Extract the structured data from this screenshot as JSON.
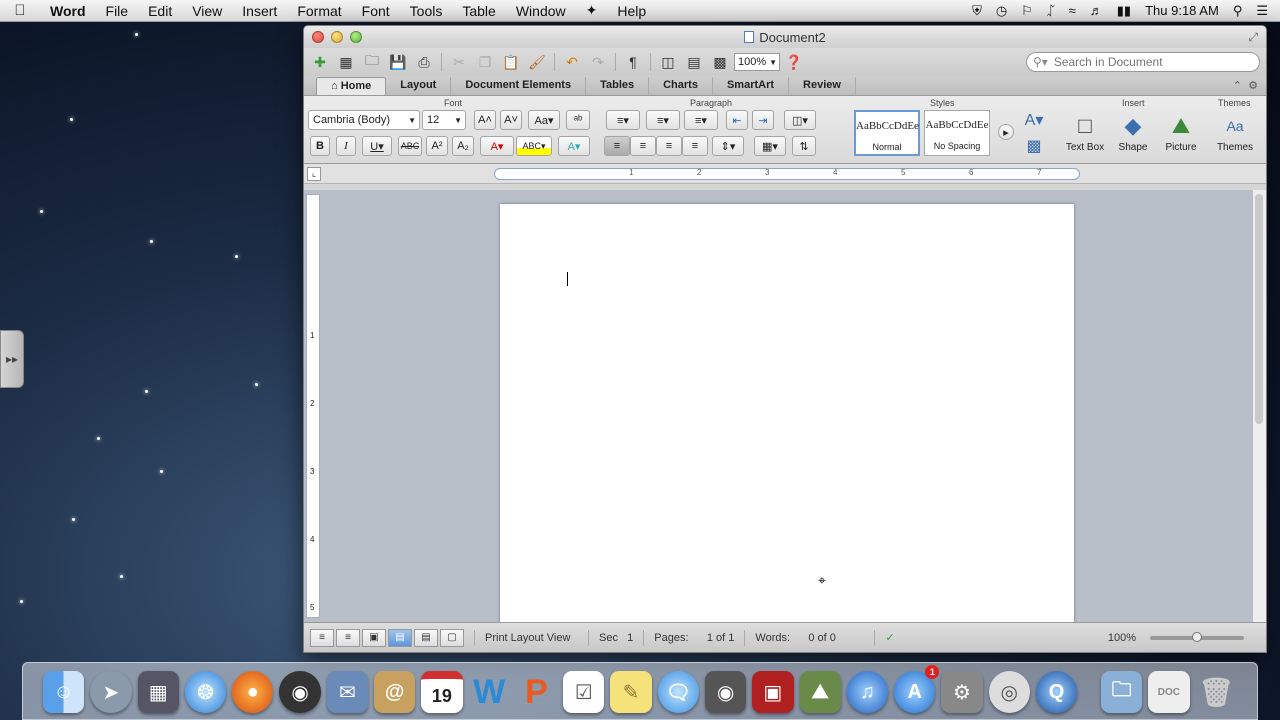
{
  "menubar": {
    "app_name": "Word",
    "items": [
      "File",
      "Edit",
      "View",
      "Insert",
      "Format",
      "Font",
      "Tools",
      "Table",
      "Window",
      "Help"
    ],
    "clock": "Thu 9:18 AM"
  },
  "window": {
    "title": "Document2"
  },
  "standard_toolbar": {
    "zoom": "100%",
    "search_placeholder": "Search in Document"
  },
  "ribbon_tabs": [
    "Home",
    "Layout",
    "Document Elements",
    "Tables",
    "Charts",
    "SmartArt",
    "Review"
  ],
  "ribbon": {
    "groups": {
      "font": "Font",
      "paragraph": "Paragraph",
      "styles": "Styles",
      "insert": "Insert",
      "themes": "Themes"
    },
    "font_name": "Cambria (Body)",
    "font_size": "12",
    "styles": [
      {
        "sample": "AaBbCcDdEe",
        "label": "Normal"
      },
      {
        "sample": "AaBbCcDdEe",
        "label": "No Spacing"
      }
    ],
    "insert_buttons": [
      "Text Box",
      "Shape",
      "Picture"
    ],
    "themes_button": "Themes"
  },
  "ruler_numbers": [
    "1",
    "2",
    "3",
    "4",
    "5",
    "6",
    "7"
  ],
  "vruler_numbers": [
    "1",
    "2",
    "3",
    "4",
    "5"
  ],
  "statusbar": {
    "view_label": "Print Layout View",
    "sec_label": "Sec",
    "sec_value": "1",
    "pages_label": "Pages:",
    "pages_value": "1 of 1",
    "words_label": "Words:",
    "words_value": "0 of 0",
    "zoom": "100%"
  },
  "dock": {
    "calendar_day": "19",
    "appstore_badge": "1"
  }
}
